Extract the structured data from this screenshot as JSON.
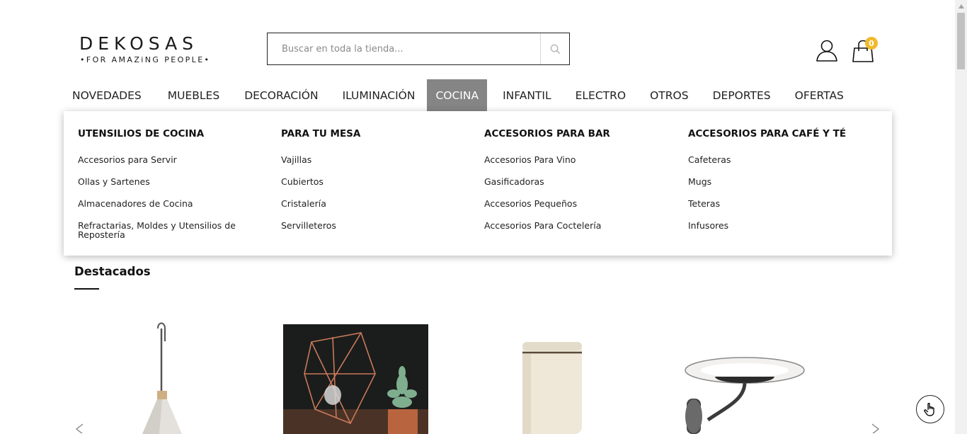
{
  "header": {
    "logo_main": "DEKOSAS",
    "logo_sub": "•FOR AMAZiNG PEOPLE•",
    "search_placeholder": "Buscar en toda la tienda...",
    "cart_count": "0"
  },
  "nav": [
    {
      "label": "NOVEDADES"
    },
    {
      "label": "MUEBLES"
    },
    {
      "label": "DECORACIÓN"
    },
    {
      "label": "ILUMINACIÓN"
    },
    {
      "label": "COCINA",
      "active": true
    },
    {
      "label": "INFANTIL"
    },
    {
      "label": "ELECTRO"
    },
    {
      "label": "OTROS"
    },
    {
      "label": "DEPORTES"
    },
    {
      "label": "OFERTAS"
    }
  ],
  "mega_menu": [
    {
      "title": "UTENSILIOS DE COCINA",
      "links": [
        "Accesorios para Servir",
        "Ollas y Sartenes",
        "Almacenadores de Cocina",
        "Refractarias, Moldes y Utensilios de Repostería"
      ]
    },
    {
      "title": "PARA TU MESA",
      "links": [
        "Vajillas",
        "Cubiertos",
        "Cristalería",
        "Servilleteros"
      ]
    },
    {
      "title": "ACCESORIOS PARA BAR",
      "links": [
        "Accesorios Para Vino",
        "Gasificadoras",
        "Accesorios Pequeños",
        "Accesorios Para Coctelería"
      ]
    },
    {
      "title": "ACCESORIOS PARA CAFÉ Y TÉ",
      "links": [
        "Cafeteras",
        "Mugs",
        "Teteras",
        "Infusores"
      ]
    }
  ],
  "featured": {
    "title": "Destacados",
    "products": [
      {
        "image": "pendant-lamp-concrete"
      },
      {
        "image": "copper-wire-lamp-with-succulent"
      },
      {
        "image": "cream-canister"
      },
      {
        "image": "chrome-wall-sconce"
      }
    ]
  },
  "colors": {
    "active_nav_bg": "#858585",
    "cart_badge": "#f2b92b",
    "text": "#111111"
  },
  "icons": [
    "search-icon",
    "user-icon",
    "shopping-bag-icon",
    "chevron-left-icon",
    "chevron-right-icon",
    "hand-pointer-icon"
  ]
}
